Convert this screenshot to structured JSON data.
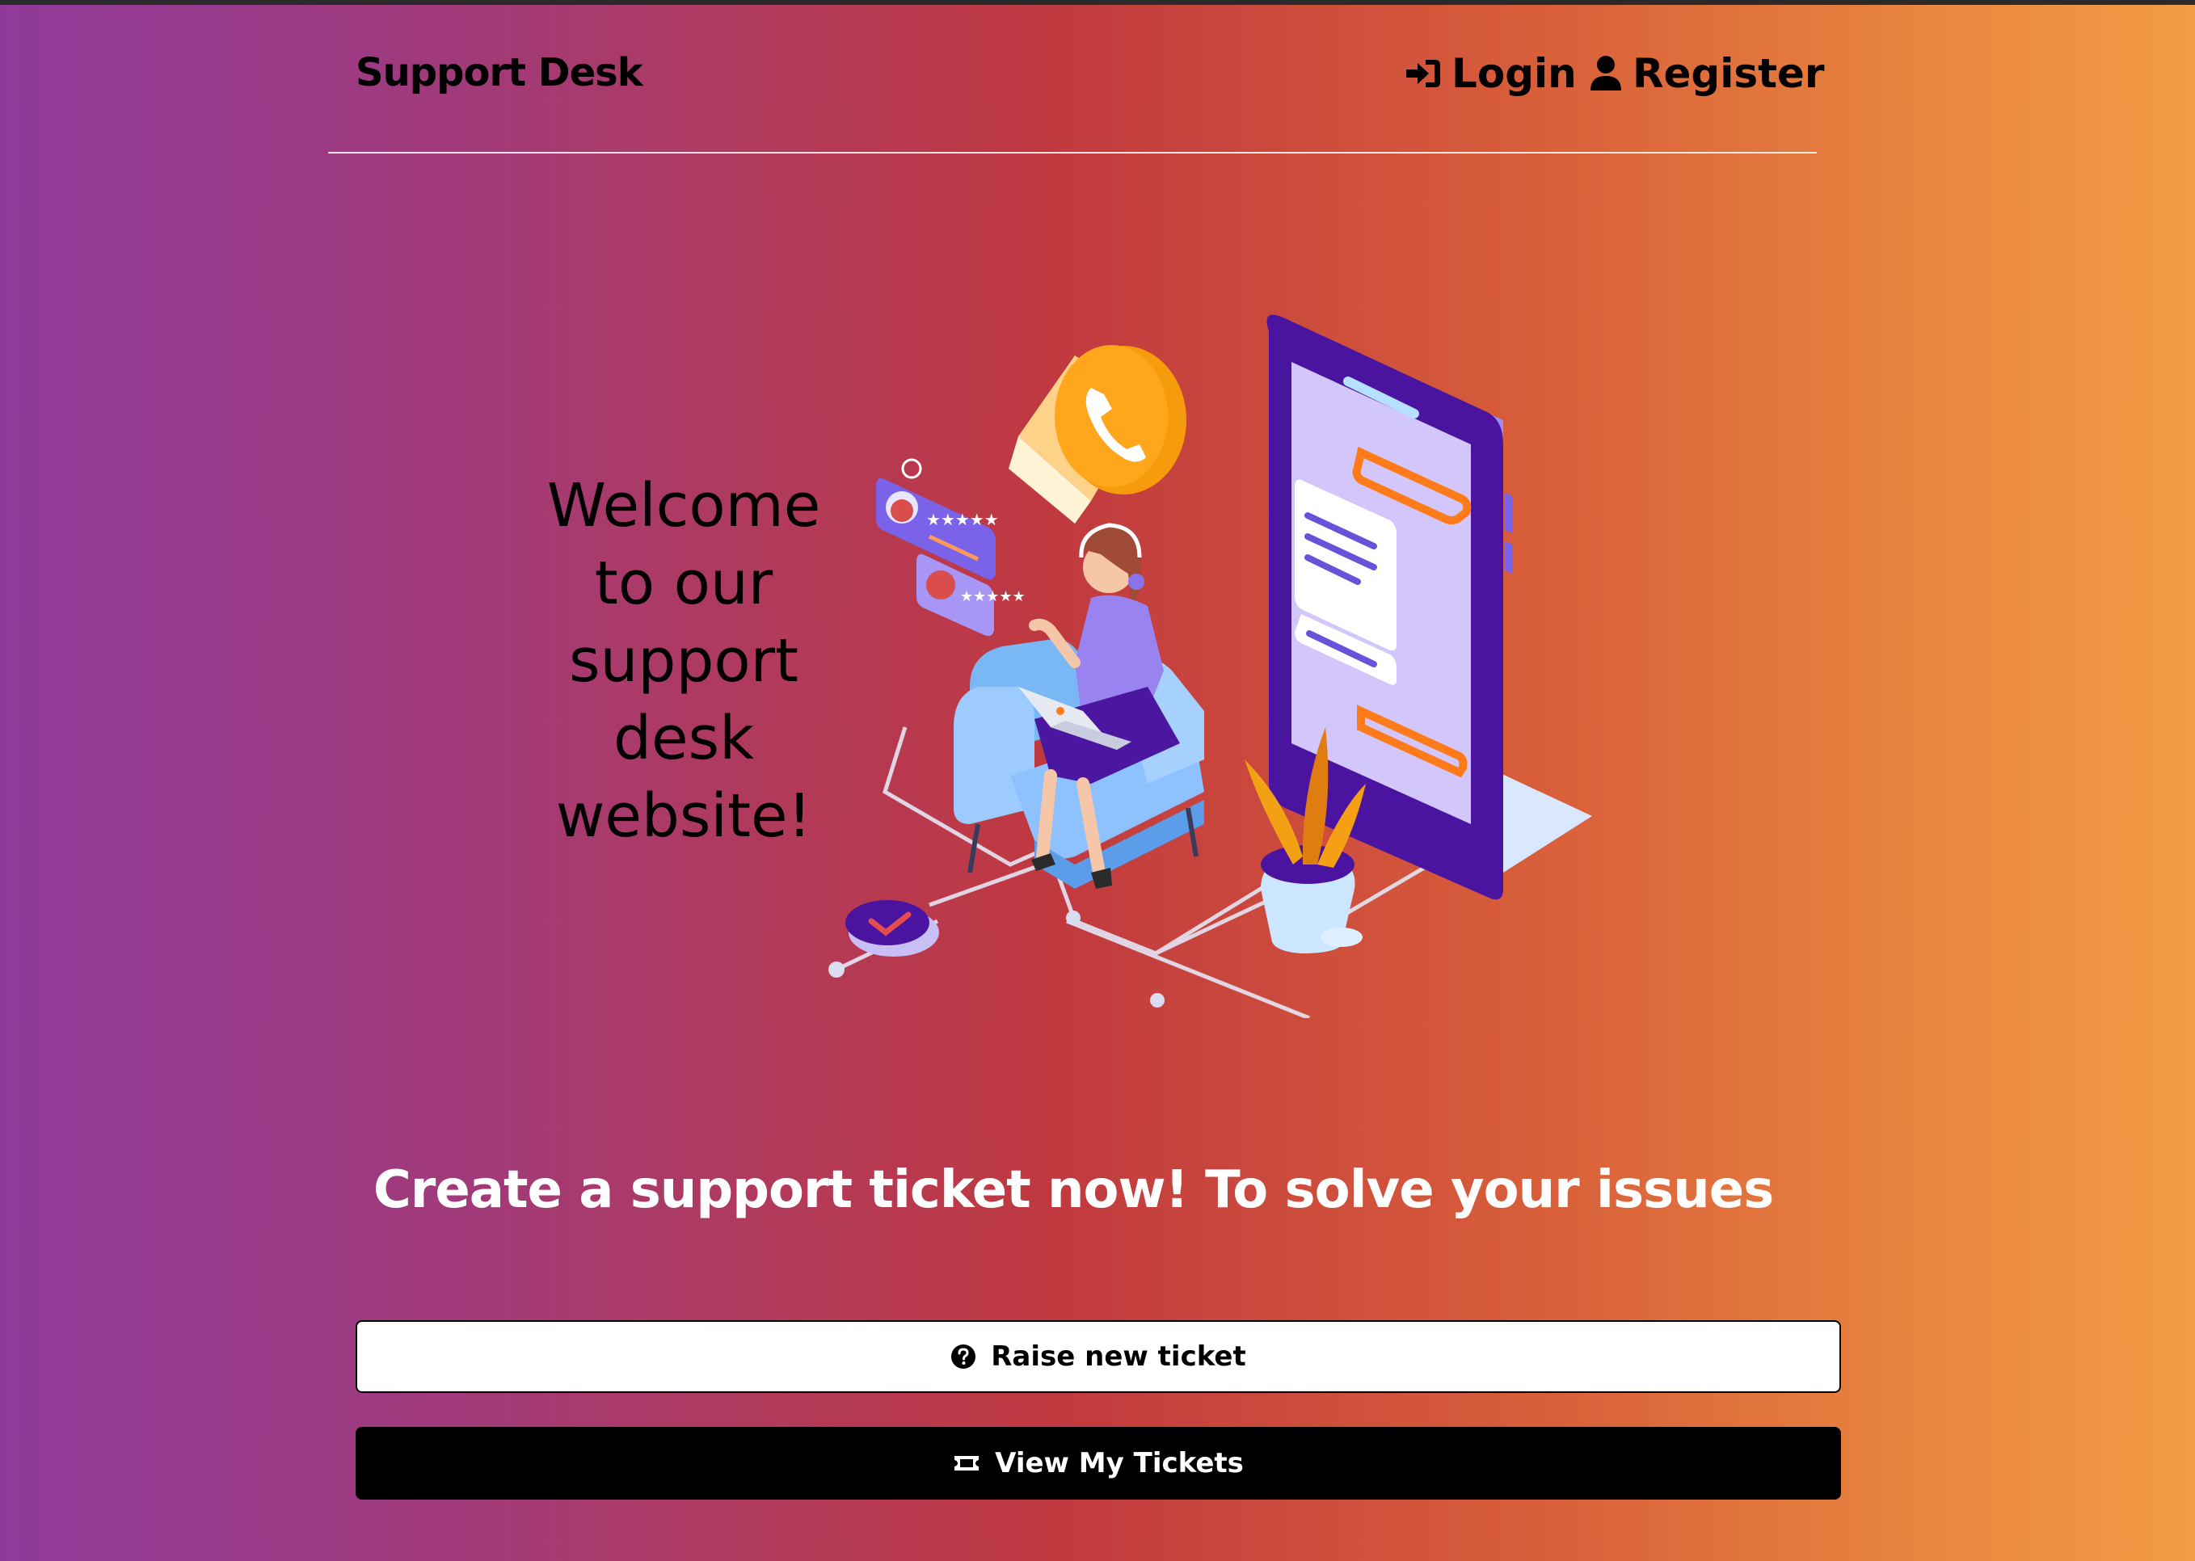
{
  "header": {
    "brand": "Support Desk",
    "nav": {
      "login_label": "Login",
      "login_icon": "sign-in-icon",
      "register_label": "Register",
      "register_icon": "user-icon"
    }
  },
  "hero": {
    "welcome_lines": [
      "Welcome",
      "to our",
      "support",
      "desk",
      "website!"
    ],
    "illustration": "customer-support-illustration"
  },
  "cta": {
    "headline": "Create a support ticket now! To solve your issues",
    "raise_label": "Raise new ticket",
    "raise_icon": "question-circle-icon",
    "view_label": "View My Tickets",
    "view_icon": "ticket-icon"
  },
  "colors": {
    "gradient_left": "#8f3a9a",
    "gradient_mid": "#c0393f",
    "gradient_right": "#f39c45",
    "accent_purple": "#4a1aa0",
    "accent_orange": "#f5a014"
  }
}
